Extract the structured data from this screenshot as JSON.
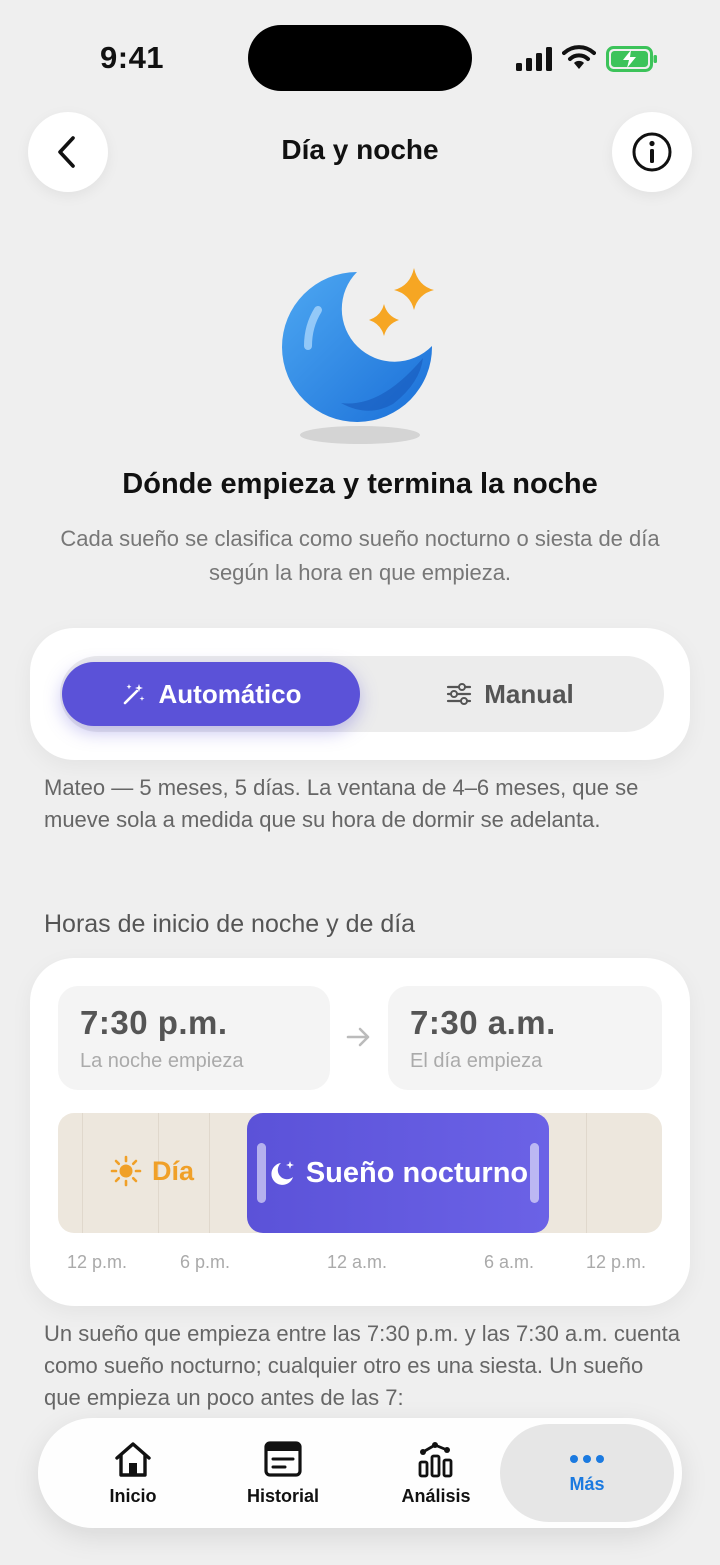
{
  "status": {
    "time": "9:41"
  },
  "header": {
    "title": "Día y noche"
  },
  "headline": "Dónde empieza y termina la noche",
  "subtitle": "Cada sueño se clasifica como sueño nocturno o siesta de día según la hora en que empieza.",
  "mode": {
    "active": "Automático",
    "inactive": "Manual"
  },
  "note": "Mateo — 5 meses, 5 días. La ventana de 4–6 meses, que se mueve sola a medida que su hora de dormir se adelanta.",
  "section_label": "Horas de inicio de noche y de día",
  "night_start": {
    "time": "7:30 p.m.",
    "label": "La noche empieza"
  },
  "day_start": {
    "time": "7:30 a.m.",
    "label": "El día empieza"
  },
  "timeline": {
    "day_label": "Día",
    "night_label": "Sueño nocturno",
    "ticks": [
      "12 p.m.",
      "6 p.m.",
      "12 a.m.",
      "6 a.m.",
      "12 p.m."
    ]
  },
  "footer_text": "Un sueño que empieza entre las 7:30 p.m. y las 7:30 a.m. cuenta como sueño nocturno; cualquier otro es una siesta. Un sueño que empieza un poco antes de las 7:",
  "tabs": [
    {
      "label": "Inicio"
    },
    {
      "label": "Historial"
    },
    {
      "label": "Análisis"
    },
    {
      "label": "Más"
    }
  ],
  "colors": {
    "accent": "#5b52d8",
    "day": "#f0a028",
    "tab_active": "#1b7ae0"
  }
}
